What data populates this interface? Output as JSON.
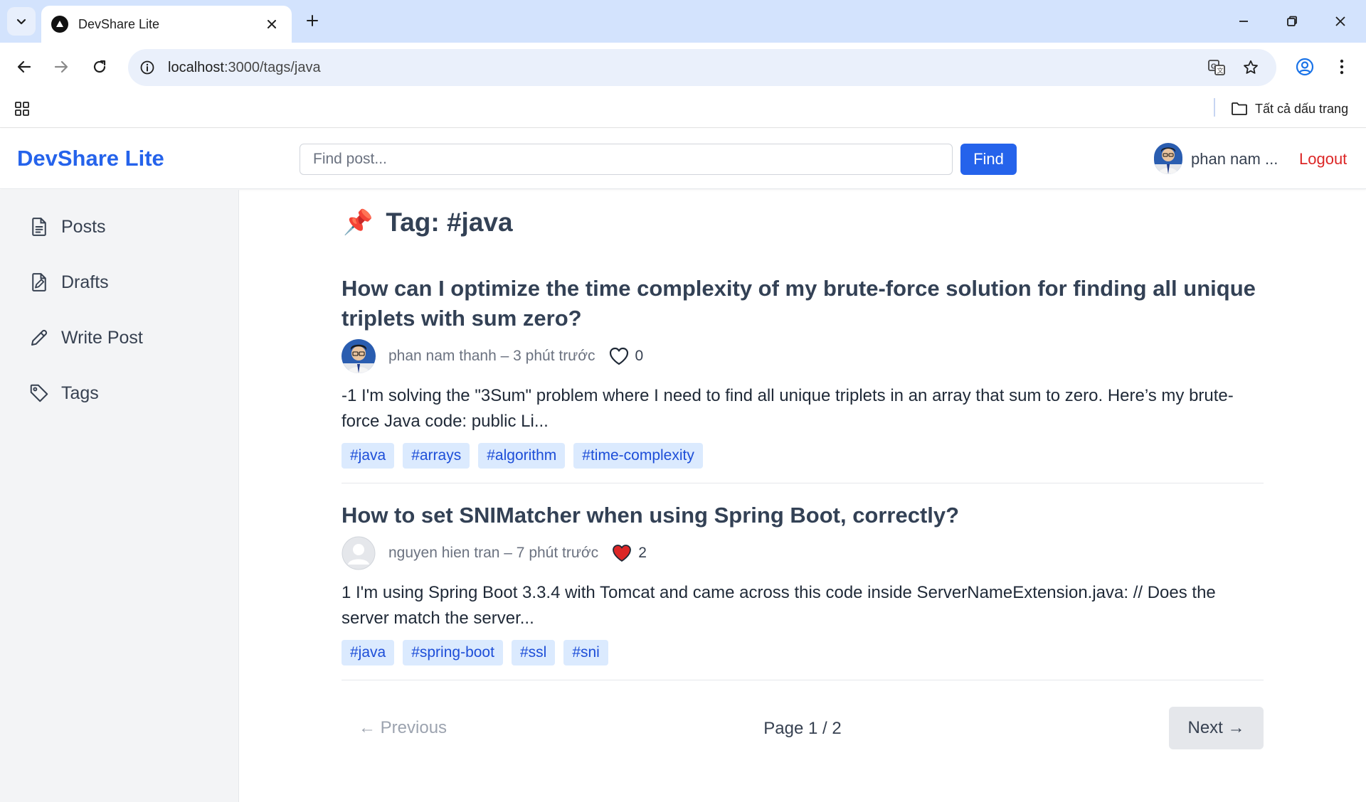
{
  "browser": {
    "tab_title": "DevShare Lite",
    "url_host": "localhost",
    "url_path": ":3000/tags/java",
    "bookmarks_all_label": "Tất cả dấu trang"
  },
  "header": {
    "brand": "DevShare Lite",
    "search_placeholder": "Find post...",
    "find_label": "Find",
    "user_name": "phan nam ...",
    "logout_label": "Logout"
  },
  "sidebar": {
    "items": [
      {
        "label": "Posts",
        "icon": "document-icon"
      },
      {
        "label": "Drafts",
        "icon": "draft-icon"
      },
      {
        "label": "Write Post",
        "icon": "pencil-icon"
      },
      {
        "label": "Tags",
        "icon": "tag-icon"
      }
    ]
  },
  "main": {
    "heading_icon": "📌",
    "heading": "Tag: #java",
    "posts": [
      {
        "title": "How can I optimize the time complexity of my brute-force solution for finding all unique triplets with sum zero?",
        "meta": "phan nam thanh – 3 phút trước",
        "likes": "0",
        "liked": false,
        "excerpt": "-1 I'm solving the \"3Sum\" problem where I need to find all unique triplets in an array that sum to zero. Here’s my brute-force Java code: public Li...",
        "tags": [
          "#java",
          "#arrays",
          "#algorithm",
          "#time-complexity"
        ]
      },
      {
        "title": "How to set SNIMatcher when using Spring Boot, correctly?",
        "meta": "nguyen hien tran – 7 phút trước",
        "likes": "2",
        "liked": true,
        "excerpt": "1 I'm using Spring Boot 3.3.4 with Tomcat and came across this code inside ServerNameExtension.java: // Does the server match the server...",
        "tags": [
          "#java",
          "#spring-boot",
          "#ssl",
          "#sni"
        ]
      }
    ]
  },
  "pagination": {
    "prev_label": "← Previous",
    "page_info": "Page 1 / 2",
    "next_label": "Next →"
  },
  "colors": {
    "brand": "#2563eb",
    "logout": "#dc2626",
    "tag_bg": "#dbeafe",
    "tag_text": "#1d4ed8",
    "liked_heart": "#dc2626"
  }
}
